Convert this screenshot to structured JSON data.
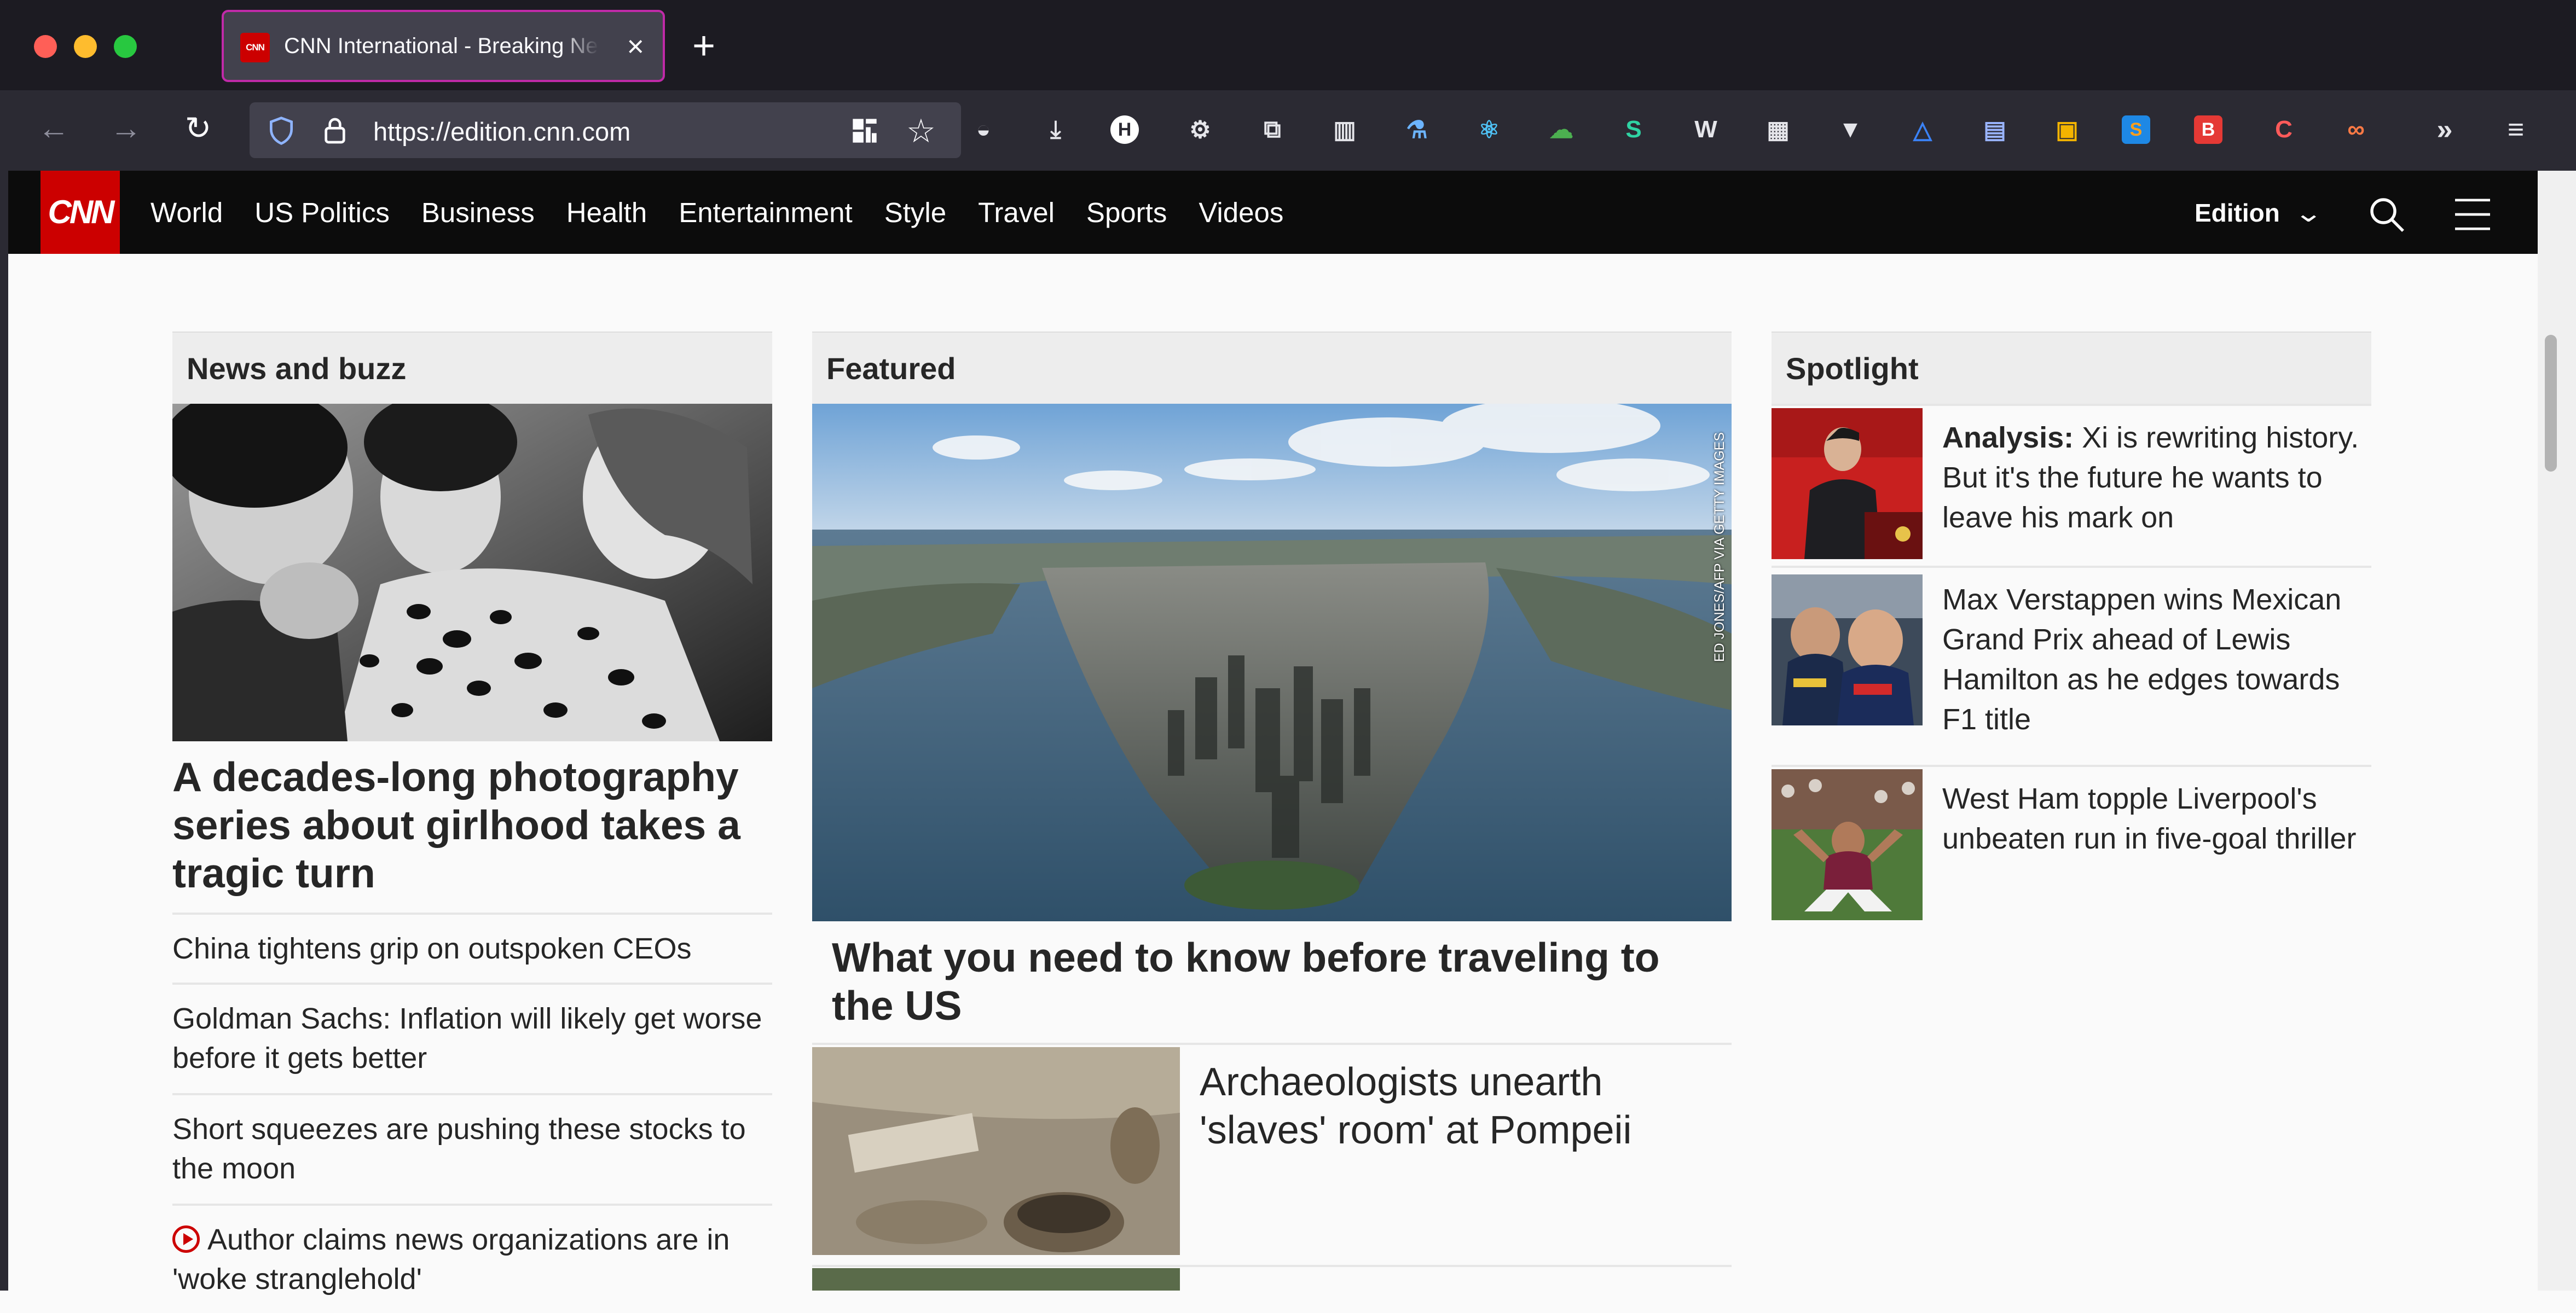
{
  "browser": {
    "tab_title": "CNN International - Breaking News",
    "tab_favicon": "CNN",
    "new_tab": "+",
    "url": "https://edition.cnn.com",
    "extensions": [
      "pocket-icon",
      "download-icon",
      "H",
      "gear-icon",
      "screenshot-icon",
      "grid-icon",
      "flask-icon",
      "react-icon",
      "cloud-icon",
      "S",
      "W",
      "apps-icon",
      "vue-icon",
      "triangle-icon",
      "layout-icon",
      "color-grid-icon",
      "S2",
      "B",
      "C",
      "glasses-icon"
    ],
    "colors": {
      "titlebar": "#1c1b22",
      "toolbar": "#2b2a33",
      "tab_border": "#c02aa8"
    }
  },
  "cnn": {
    "logo": "CNN",
    "nav": [
      "World",
      "US Politics",
      "Business",
      "Health",
      "Entertainment",
      "Style",
      "Travel",
      "Sports",
      "Videos"
    ],
    "edition_label": "Edition",
    "brand_color": "#cc0000"
  },
  "news_buzz": {
    "heading": "News and buzz",
    "lead_headline": "A decades-long photography series about girlhood takes a tragic turn",
    "items": [
      "China tightens grip on outspoken CEOs",
      "Goldman Sachs: Inflation will likely get worse before it gets better",
      "Short squeezes are pushing these stocks to the moon",
      "Author claims news organizations are in 'woke stranglehold'"
    ]
  },
  "featured": {
    "heading": "Featured",
    "image_credit": "ED JONES/AFP VIA GETTY IMAGES",
    "lead_headline": "What you need to know before traveling to the US",
    "second_headline": "Archaeologists unearth 'slaves' room' at Pompeii"
  },
  "spotlight": {
    "heading": "Spotlight",
    "items": [
      {
        "prefix": "Analysis:",
        "text": " Xi is rewriting history. But it's the future he wants to leave his mark on"
      },
      {
        "prefix": "",
        "text": "Max Verstappen wins Mexican Grand Prix ahead of Lewis Hamilton as he edges towards F1 title"
      },
      {
        "prefix": "",
        "text": "West Ham topple Liverpool's unbeaten run in five-goal thriller"
      }
    ]
  }
}
